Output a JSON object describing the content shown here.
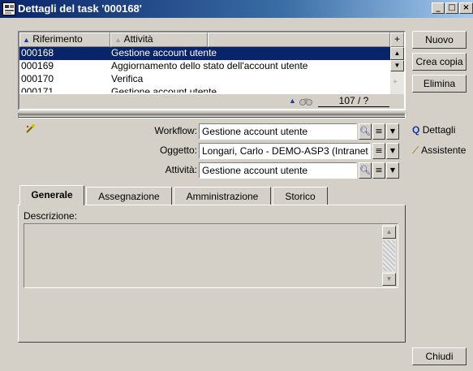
{
  "window": {
    "title": "Dettagli del task '000168'",
    "buttons": [
      "_",
      "□",
      "×"
    ]
  },
  "list": {
    "columns": [
      {
        "label": "Riferimento",
        "sort": "▲"
      },
      {
        "label": "Attività",
        "sort": ""
      }
    ],
    "header_plus": "+",
    "rows": [
      {
        "ref": "000168",
        "activity": "Gestione account utente",
        "selected": true
      },
      {
        "ref": "000169",
        "activity": "Aggiornamento dello stato dell'account utente",
        "selected": false
      },
      {
        "ref": "000170",
        "activity": "Verifica",
        "selected": false
      },
      {
        "ref": "000171",
        "activity": "Gestione account utente",
        "selected": false
      }
    ],
    "counter": "107 / ?",
    "nav_arrow": "▲"
  },
  "right_buttons": {
    "new": "Nuovo",
    "copy": "Crea copia",
    "delete": "Elimina"
  },
  "form": {
    "workflow": {
      "label": "Workflow:",
      "value": "Gestione account utente"
    },
    "object": {
      "label": "Oggetto:",
      "value": "Longari, Carlo - DEMO-ASP3 (Intranet"
    },
    "activity": {
      "label": "Attività:",
      "value": "Gestione account utente"
    }
  },
  "side_buttons": {
    "details": "Dettagli",
    "wizard": "Assistente"
  },
  "tabs": [
    {
      "label": "Generale",
      "active": true
    },
    {
      "label": "Assegnazione",
      "active": false
    },
    {
      "label": "Amministrazione",
      "active": false
    },
    {
      "label": "Storico",
      "active": false
    }
  ],
  "general": {
    "description_label": "Descrizione:",
    "description_value": ""
  },
  "footer": {
    "close": "Chiudi"
  }
}
